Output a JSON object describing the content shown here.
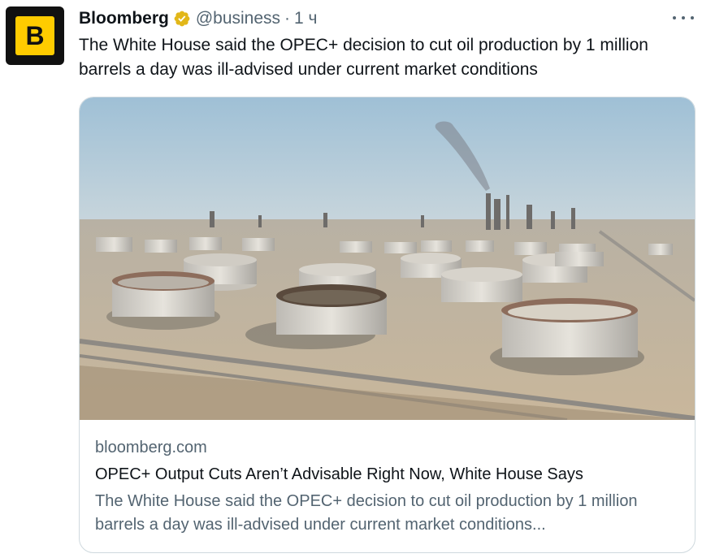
{
  "tweet": {
    "author_name": "Bloomberg",
    "avatar_letter": "B",
    "handle": "@business",
    "separator": "·",
    "time": "1 ч",
    "text": "The White House said the OPEC+ decision to cut oil production by 1 million barrels a day was ill-advised under current market conditions"
  },
  "card": {
    "image_icon": "oil-storage-tanks-photo",
    "domain": "bloomberg.com",
    "title": "OPEC+ Output Cuts Aren’t Advisable Right Now, White House Says",
    "description": "The White House said the OPEC+ decision to cut oil production by 1 million barrels a day was ill-advised under current market conditions..."
  },
  "colors": {
    "brand_yellow": "#ffcc00",
    "verified_gold": "#e2b719",
    "text_primary": "#0f1419",
    "text_secondary": "#536471",
    "border": "#cfd9de"
  }
}
